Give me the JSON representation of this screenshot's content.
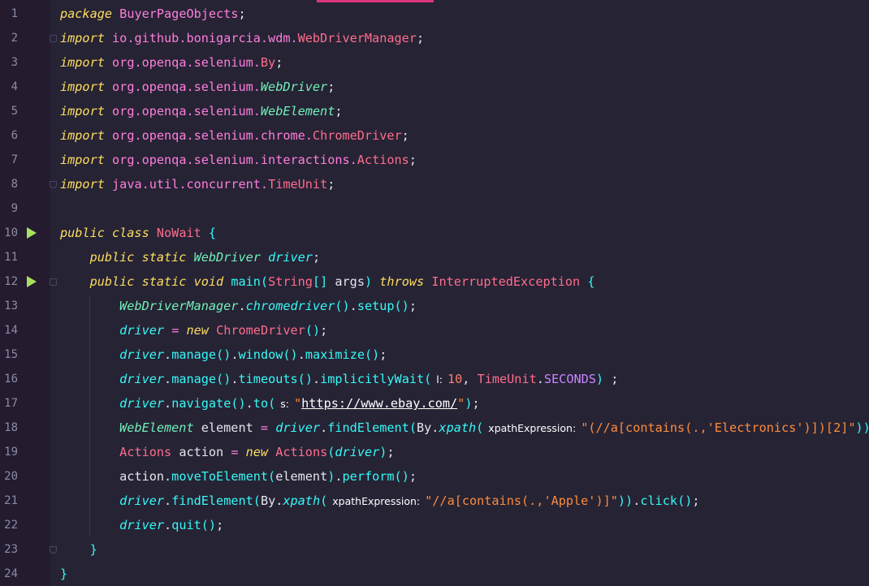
{
  "editor": {
    "language": "java",
    "colors": {
      "background": "#262335",
      "keyword": "#fede5d",
      "run_marker": "#a8e05f",
      "tab_indicator": "#d8367a"
    },
    "lines": [
      {
        "n": "1",
        "tokens": [
          [
            "kw",
            "package"
          ],
          [
            "pl",
            " "
          ],
          [
            "pkg",
            "BuyerPageObjects"
          ],
          [
            "pl",
            ";"
          ]
        ]
      },
      {
        "n": "2",
        "tokens": [
          [
            "kw",
            "import"
          ],
          [
            "pl",
            " "
          ],
          [
            "pkg",
            "io.github.bonigarcia.wdm."
          ],
          [
            "typ",
            "WebDriverManager"
          ],
          [
            "pl",
            ";"
          ]
        ]
      },
      {
        "n": "3",
        "tokens": [
          [
            "kw",
            "import"
          ],
          [
            "pl",
            " "
          ],
          [
            "pkg",
            "org.openqa.selenium."
          ],
          [
            "typ",
            "By"
          ],
          [
            "pl",
            ";"
          ]
        ]
      },
      {
        "n": "4",
        "tokens": [
          [
            "kw",
            "import"
          ],
          [
            "pl",
            " "
          ],
          [
            "pkg",
            "org.openqa.selenium."
          ],
          [
            "it",
            "WebDriver"
          ],
          [
            "pl",
            ";"
          ]
        ]
      },
      {
        "n": "5",
        "tokens": [
          [
            "kw",
            "import"
          ],
          [
            "pl",
            " "
          ],
          [
            "pkg",
            "org.openqa.selenium."
          ],
          [
            "it",
            "WebElement"
          ],
          [
            "pl",
            ";"
          ]
        ]
      },
      {
        "n": "6",
        "tokens": [
          [
            "kw",
            "import"
          ],
          [
            "pl",
            " "
          ],
          [
            "pkg",
            "org.openqa.selenium.chrome."
          ],
          [
            "typ",
            "ChromeDriver"
          ],
          [
            "pl",
            ";"
          ]
        ]
      },
      {
        "n": "7",
        "tokens": [
          [
            "kw",
            "import"
          ],
          [
            "pl",
            " "
          ],
          [
            "pkg",
            "org.openqa.selenium.interactions."
          ],
          [
            "typ",
            "Actions"
          ],
          [
            "pl",
            ";"
          ]
        ]
      },
      {
        "n": "8",
        "tokens": [
          [
            "kw",
            "import"
          ],
          [
            "pl",
            " "
          ],
          [
            "pkg",
            "java.util.concurrent."
          ],
          [
            "typ",
            "TimeUnit"
          ],
          [
            "pl",
            ";"
          ]
        ]
      },
      {
        "n": "9",
        "tokens": []
      },
      {
        "n": "10",
        "tokens": [
          [
            "kw",
            "public class"
          ],
          [
            "pl",
            " "
          ],
          [
            "typ",
            "NoWait"
          ],
          [
            "pl",
            " "
          ],
          [
            "fn",
            "{"
          ]
        ]
      },
      {
        "n": "11",
        "tokens": [
          [
            "pl",
            "    "
          ],
          [
            "kw",
            "public static"
          ],
          [
            "pl",
            " "
          ],
          [
            "it",
            "WebDriver"
          ],
          [
            "pl",
            " "
          ],
          [
            "var",
            "driver"
          ],
          [
            "pl",
            ";"
          ]
        ]
      },
      {
        "n": "12",
        "tokens": [
          [
            "pl",
            "    "
          ],
          [
            "kw",
            "public static void"
          ],
          [
            "pl",
            " "
          ],
          [
            "fn",
            "main"
          ],
          [
            "fn",
            "("
          ],
          [
            "typ",
            "String"
          ],
          [
            "fn",
            "[]"
          ],
          [
            "pl",
            " "
          ],
          [
            "pl",
            "args"
          ],
          [
            "fn",
            ")"
          ],
          [
            "pl",
            " "
          ],
          [
            "kw",
            "throws"
          ],
          [
            "pl",
            " "
          ],
          [
            "typ",
            "InterruptedException"
          ],
          [
            "pl",
            " "
          ],
          [
            "fn",
            "{"
          ]
        ]
      },
      {
        "n": "13",
        "tokens": [
          [
            "pl",
            "        "
          ],
          [
            "it",
            "WebDriverManager"
          ],
          [
            "pl",
            "."
          ],
          [
            "var",
            "chromedriver"
          ],
          [
            "fn",
            "()"
          ],
          [
            "pl",
            "."
          ],
          [
            "fn",
            "setup"
          ],
          [
            "fn",
            "()"
          ],
          [
            "pl",
            ";"
          ]
        ]
      },
      {
        "n": "14",
        "tokens": [
          [
            "pl",
            "        "
          ],
          [
            "var",
            "driver"
          ],
          [
            "pl",
            " "
          ],
          [
            "pkg",
            "="
          ],
          [
            "pl",
            " "
          ],
          [
            "kw",
            "new"
          ],
          [
            "pl",
            " "
          ],
          [
            "typ",
            "ChromeDriver"
          ],
          [
            "fn",
            "()"
          ],
          [
            "pl",
            ";"
          ]
        ]
      },
      {
        "n": "15",
        "tokens": [
          [
            "pl",
            "        "
          ],
          [
            "var",
            "driver"
          ],
          [
            "pl",
            "."
          ],
          [
            "fn",
            "manage"
          ],
          [
            "fn",
            "()"
          ],
          [
            "pl",
            "."
          ],
          [
            "fn",
            "window"
          ],
          [
            "fn",
            "()"
          ],
          [
            "pl",
            "."
          ],
          [
            "fn",
            "maximize"
          ],
          [
            "fn",
            "()"
          ],
          [
            "pl",
            ";"
          ]
        ]
      },
      {
        "n": "16",
        "tokens": [
          [
            "pl",
            "        "
          ],
          [
            "var",
            "driver"
          ],
          [
            "pl",
            "."
          ],
          [
            "fn",
            "manage"
          ],
          [
            "fn",
            "()"
          ],
          [
            "pl",
            "."
          ],
          [
            "fn",
            "timeouts"
          ],
          [
            "fn",
            "()"
          ],
          [
            "pl",
            "."
          ],
          [
            "fn",
            "implicitlyWait"
          ],
          [
            "fn",
            "("
          ],
          [
            "hint",
            "l:"
          ],
          [
            "num",
            "10"
          ],
          [
            "pl",
            ", "
          ],
          [
            "typ",
            "TimeUnit"
          ],
          [
            "pl",
            "."
          ],
          [
            "const",
            "SECONDS"
          ],
          [
            "fn",
            ")"
          ],
          [
            "pl",
            " ;"
          ]
        ]
      },
      {
        "n": "17",
        "tokens": [
          [
            "pl",
            "        "
          ],
          [
            "var",
            "driver"
          ],
          [
            "pl",
            "."
          ],
          [
            "fn",
            "navigate"
          ],
          [
            "fn",
            "()"
          ],
          [
            "pl",
            "."
          ],
          [
            "fn",
            "to"
          ],
          [
            "fn",
            "("
          ],
          [
            "hint",
            "s:"
          ],
          [
            "str",
            "\""
          ],
          [
            "url",
            "https://www.ebay.com/"
          ],
          [
            "str",
            "\""
          ],
          [
            "fn",
            ")"
          ],
          [
            "pl",
            ";"
          ]
        ]
      },
      {
        "n": "18",
        "tokens": [
          [
            "pl",
            "        "
          ],
          [
            "it",
            "WebElement"
          ],
          [
            "pl",
            " element "
          ],
          [
            "pkg",
            "="
          ],
          [
            "pl",
            " "
          ],
          [
            "var",
            "driver"
          ],
          [
            "pl",
            "."
          ],
          [
            "fn",
            "findElement"
          ],
          [
            "fn",
            "("
          ],
          [
            "pl",
            "By."
          ],
          [
            "var",
            "xpath"
          ],
          [
            "fn",
            "("
          ],
          [
            "hint",
            "xpathExpression:"
          ],
          [
            "str",
            "\"(//a[contains(.,'Electronics')])[2]\""
          ],
          [
            "fn",
            "))"
          ],
          [
            "pl",
            ";"
          ]
        ]
      },
      {
        "n": "19",
        "tokens": [
          [
            "pl",
            "        "
          ],
          [
            "typ",
            "Actions"
          ],
          [
            "pl",
            " action "
          ],
          [
            "pkg",
            "="
          ],
          [
            "pl",
            " "
          ],
          [
            "kw",
            "new"
          ],
          [
            "pl",
            " "
          ],
          [
            "typ",
            "Actions"
          ],
          [
            "fn",
            "("
          ],
          [
            "var",
            "driver"
          ],
          [
            "fn",
            ")"
          ],
          [
            "pl",
            ";"
          ]
        ]
      },
      {
        "n": "20",
        "tokens": [
          [
            "pl",
            "        "
          ],
          [
            "pl",
            "action."
          ],
          [
            "fn",
            "moveToElement"
          ],
          [
            "fn",
            "("
          ],
          [
            "pl",
            "element"
          ],
          [
            "fn",
            ")"
          ],
          [
            "pl",
            "."
          ],
          [
            "fn",
            "perform"
          ],
          [
            "fn",
            "()"
          ],
          [
            "pl",
            ";"
          ]
        ]
      },
      {
        "n": "21",
        "tokens": [
          [
            "pl",
            "        "
          ],
          [
            "var",
            "driver"
          ],
          [
            "pl",
            "."
          ],
          [
            "fn",
            "findElement"
          ],
          [
            "fn",
            "("
          ],
          [
            "pl",
            "By."
          ],
          [
            "var",
            "xpath"
          ],
          [
            "fn",
            "("
          ],
          [
            "hint",
            "xpathExpression:"
          ],
          [
            "str",
            "\"//a[contains(.,'Apple')]\""
          ],
          [
            "fn",
            "))"
          ],
          [
            "pl",
            "."
          ],
          [
            "fn",
            "click"
          ],
          [
            "fn",
            "()"
          ],
          [
            "pl",
            ";"
          ]
        ]
      },
      {
        "n": "22",
        "tokens": [
          [
            "pl",
            "        "
          ],
          [
            "var",
            "driver"
          ],
          [
            "pl",
            "."
          ],
          [
            "fn",
            "quit"
          ],
          [
            "fn",
            "()"
          ],
          [
            "pl",
            ";"
          ]
        ]
      },
      {
        "n": "23",
        "tokens": [
          [
            "pl",
            "    "
          ],
          [
            "fn",
            "}"
          ]
        ]
      },
      {
        "n": "24",
        "tokens": [
          [
            "fn",
            "}"
          ]
        ]
      }
    ]
  }
}
